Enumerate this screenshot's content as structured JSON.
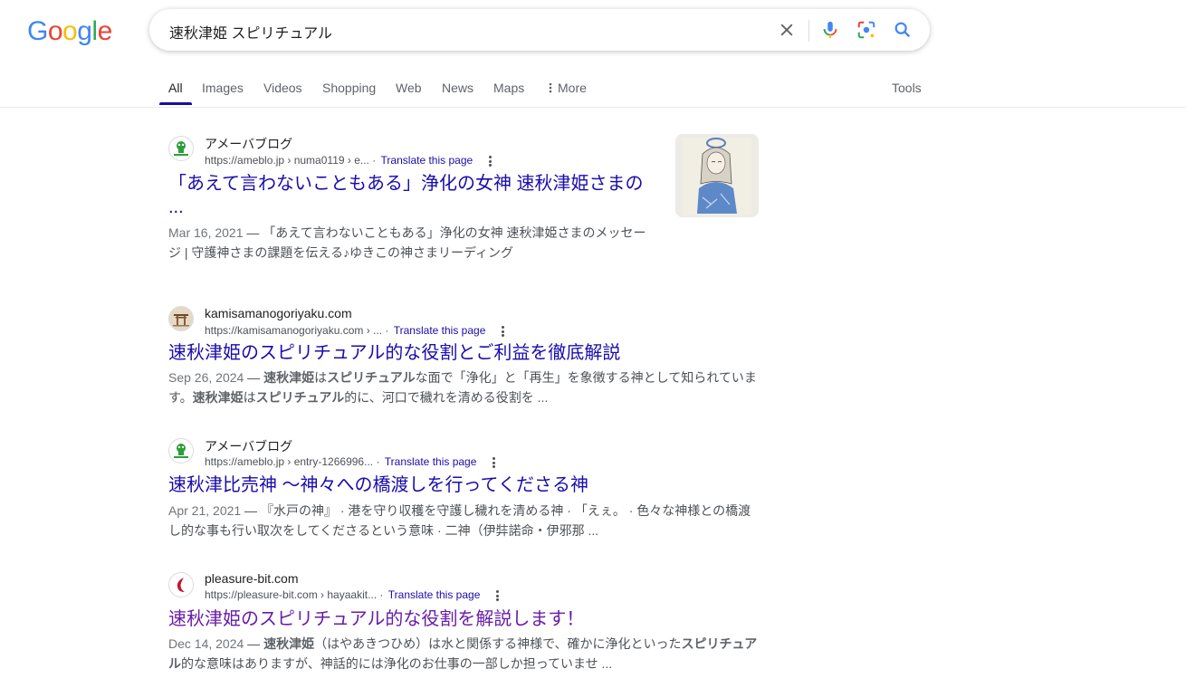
{
  "logo": "Google",
  "search": {
    "query": "速秋津姫 スピリチュアル"
  },
  "tabs": [
    "All",
    "Images",
    "Videos",
    "Shopping",
    "Web",
    "News",
    "Maps",
    "More"
  ],
  "tools": "Tools",
  "results": [
    {
      "site": "アメーバブログ",
      "url": "https://ameblo.jp › numa0119 › e...",
      "translate": "Translate this page",
      "title_line1": "「あえて言わないこともある」浄化の女神 速秋津姫さまの",
      "title_line2": "...",
      "date": "Mar 16, 2021",
      "snippet_line1": "「あえて言わないこともある」浄化の女神 速秋津姫さまのメッセー",
      "snippet_line2": "ジ | 守護神さまの課題を伝える♪ゆきこの神さまリーディング"
    },
    {
      "site": "kamisamanogoriyaku.com",
      "url": "https://kamisamanogoriyaku.com › ...",
      "translate": "Translate this page",
      "title": "速秋津姫のスピリチュアル的な役割とご利益を徹底解説",
      "date": "Sep 26, 2024",
      "snippet_b1": "速秋津姫",
      "snippet_t1": "は",
      "snippet_b2": "スピリチュアル",
      "snippet_t2": "な面で「浄化」と「再生」を象徴する神として知られていま",
      "snippet_t3": "す。",
      "snippet_b3": "速秋津姫",
      "snippet_t4": "は",
      "snippet_b4": "スピリチュアル",
      "snippet_t5": "的に、河口で穢れを清める役割を ..."
    },
    {
      "site": "アメーバブログ",
      "url": "https://ameblo.jp › entry-1266996...",
      "translate": "Translate this page",
      "title": "速秋津比売神 ～神々への橋渡しを行ってくださる神",
      "date": "Apr 21, 2021",
      "snippet_line1": "『水戸の神』 · 港を守り収穫を守護し穢れを清める神 · 「えぇ。 · 色々な神様との橋渡",
      "snippet_line2": "し的な事も行い取次をしてくださるという意味 · 二神（伊弉諾命・伊邪那 ..."
    },
    {
      "site": "pleasure-bit.com",
      "url": "https://pleasure-bit.com › hayaakit...",
      "translate": "Translate this page",
      "title": "速秋津姫のスピリチュアル的な役割を解説します！",
      "date": "Dec 14, 2024",
      "snippet_b1": "速秋津姫",
      "snippet_t1": "（はやあきつひめ）は水と関係する神様で、確かに浄化といった",
      "snippet_b2": "スピリチュア",
      "snippet_b3": "ル",
      "snippet_t2": "的な意味はありますが、神話的には浄化のお仕事の一部しか担っていませ ..."
    }
  ],
  "icons": [
    "close-icon",
    "mic-icon",
    "lens-icon",
    "search-icon",
    "more-vert-icon",
    "ameba-icon",
    "shrine-icon",
    "pleasure-bit-icon"
  ]
}
